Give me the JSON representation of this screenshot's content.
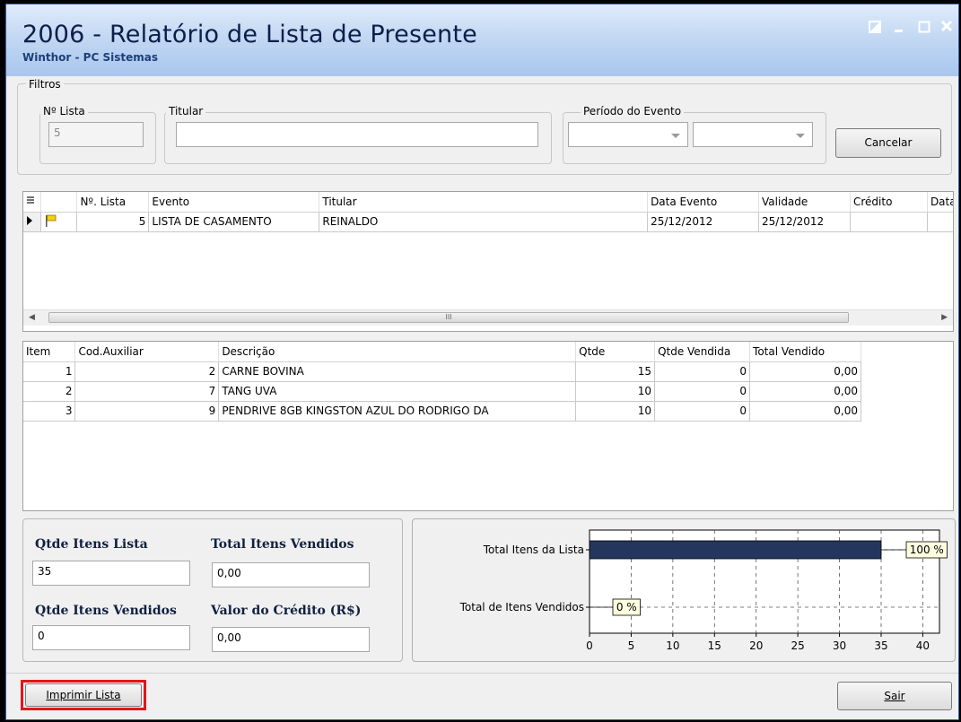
{
  "window": {
    "title": "2006 - Relatório de Lista de Presente",
    "subtitle": "Winthor - PC Sistemas",
    "controls": [
      "restore",
      "minimize",
      "maximize",
      "close"
    ]
  },
  "filters": {
    "group_label": "Filtros",
    "lista_label": "Nº Lista",
    "lista_value": "5",
    "titular_label": "Titular",
    "titular_value": "",
    "periodo_label": "Período do Evento",
    "periodo_start": "",
    "periodo_end": "",
    "cancel_label": "Cancelar"
  },
  "lists_table": {
    "columns": [
      "Nº. Lista",
      "Evento",
      "Titular",
      "Data Evento",
      "Validade",
      "Crédito",
      "Data"
    ],
    "rows": [
      {
        "lista": "5",
        "evento": "LISTA DE CASAMENTO",
        "titular": "REINALDO",
        "data_evento": "25/12/2012",
        "validade": "25/12/2012",
        "credito": "",
        "data": ""
      }
    ],
    "scroll_grip": "III"
  },
  "items_table": {
    "columns": [
      "Item",
      "Cod.Auxiliar",
      "Descrição",
      "Qtde",
      "Qtde Vendida",
      "Total Vendido"
    ],
    "rows": [
      {
        "item": "1",
        "cod": "2",
        "descricao": "CARNE BOVINA",
        "qtde": "15",
        "vendida": "0",
        "total": "0,00"
      },
      {
        "item": "2",
        "cod": "7",
        "descricao": "TANG UVA",
        "qtde": "10",
        "vendida": "0",
        "total": "0,00"
      },
      {
        "item": "3",
        "cod": "9",
        "descricao": "PENDRIVE 8GB KINGSTON AZUL DO RODRIGO DA",
        "qtde": "10",
        "vendida": "0",
        "total": "0,00"
      }
    ]
  },
  "summary": {
    "qtde_itens_lista_label": "Qtde Itens Lista",
    "qtde_itens_lista": "35",
    "total_itens_vendidos_label": "Total Itens Vendidos",
    "total_itens_vendidos": "0,00",
    "qtde_itens_vendidos_label": "Qtde Itens Vendidos",
    "qtde_itens_vendidos": "0",
    "valor_credito_label": "Valor do Crédito (R$)",
    "valor_credito": "0,00"
  },
  "chart_data": {
    "type": "bar",
    "orientation": "horizontal",
    "categories": [
      "Total Itens da Lista",
      "Total de Itens Vendidos"
    ],
    "values": [
      35,
      0
    ],
    "data_labels": [
      "100 %",
      "0 %"
    ],
    "xlim": [
      0,
      42
    ],
    "xticks": [
      0,
      5,
      10,
      15,
      20,
      25,
      30,
      35,
      40
    ],
    "grid": true,
    "bar_color": "#24365e"
  },
  "footer": {
    "print_label": "Imprimir Lista",
    "exit_label": "Sair",
    "highlight_color": "#e0161b"
  }
}
